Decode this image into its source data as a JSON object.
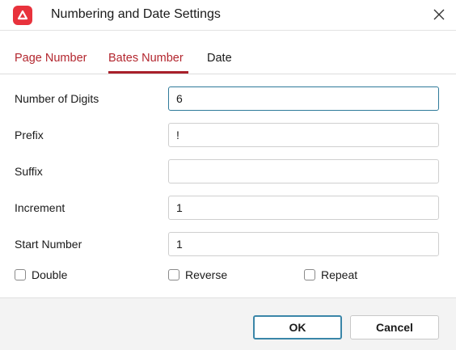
{
  "window": {
    "title": "Numbering and Date Settings"
  },
  "icons": {
    "app": "app-logo-icon",
    "close": "close-icon"
  },
  "colors": {
    "accent": "#a8202a",
    "tab_text": "#b3262e",
    "focus": "#2f7a9a",
    "ok_border": "#3a86a8",
    "app_icon_bg": "#e8323c"
  },
  "tabs": [
    {
      "label": "Page Number",
      "selected": false
    },
    {
      "label": "Bates Number",
      "selected": true
    },
    {
      "label": "Date",
      "selected": false
    }
  ],
  "form": {
    "digits": {
      "label": "Number of Digits",
      "value": "6"
    },
    "prefix": {
      "label": "Prefix",
      "value": "!"
    },
    "suffix": {
      "label": "Suffix",
      "value": ""
    },
    "increment": {
      "label": "Increment",
      "value": "1"
    },
    "start": {
      "label": "Start Number",
      "value": "1"
    }
  },
  "options": {
    "double": {
      "label": "Double",
      "checked": false
    },
    "reverse": {
      "label": "Reverse",
      "checked": false
    },
    "repeat": {
      "label": "Repeat",
      "checked": false
    }
  },
  "buttons": {
    "ok": "OK",
    "cancel": "Cancel"
  }
}
